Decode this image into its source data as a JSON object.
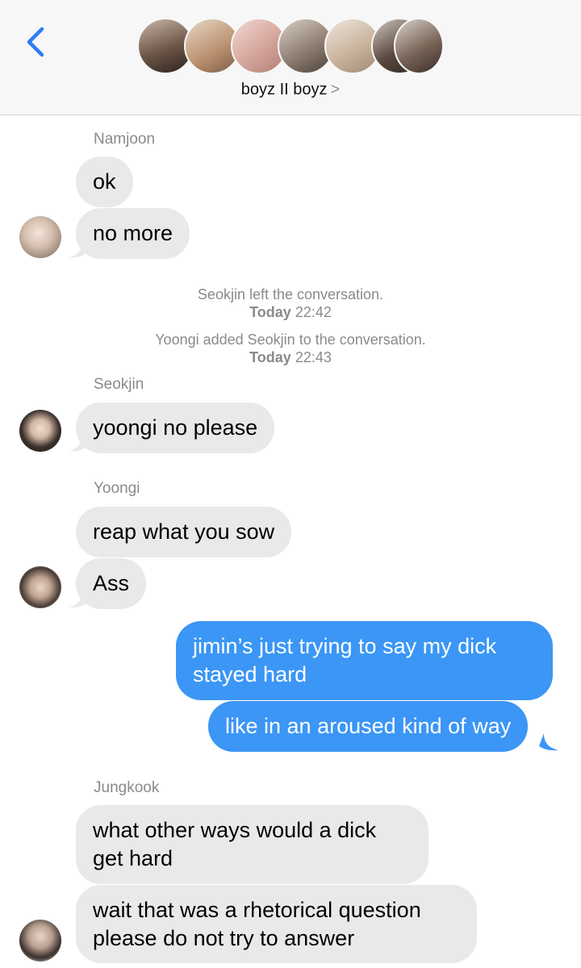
{
  "header": {
    "title": "boyz II boyz",
    "chevron": ">",
    "back_icon": "chevron-left-icon",
    "accent": "#2f7cf6"
  },
  "messages": {
    "namjoon": {
      "sender": "Namjoon",
      "b1": "ok",
      "b2": "no more"
    },
    "system": [
      {
        "text": "Seokjin left the conversation.",
        "day": "Today",
        "time": "22:42"
      },
      {
        "text": "Yoongi added Seokjin to the conversation.",
        "day": "Today",
        "time": "22:43"
      }
    ],
    "seokjin": {
      "sender": "Seokjin",
      "b1": "yoongi no please"
    },
    "yoongi": {
      "sender": "Yoongi",
      "b1": "reap what you sow",
      "b2": "Ass"
    },
    "me": {
      "b1": "jimin’s just trying to say my dick stayed hard",
      "b2": "like in an aroused kind of way"
    },
    "jungkook": {
      "sender": "Jungkook",
      "b1": "what other ways would a dick get hard",
      "b2": "wait that was a rhetorical question please do not try to answer"
    }
  },
  "colors": {
    "incoming": "#e9e9eb",
    "outgoing": "#3b96f5",
    "meta": "#8a8a8e"
  }
}
